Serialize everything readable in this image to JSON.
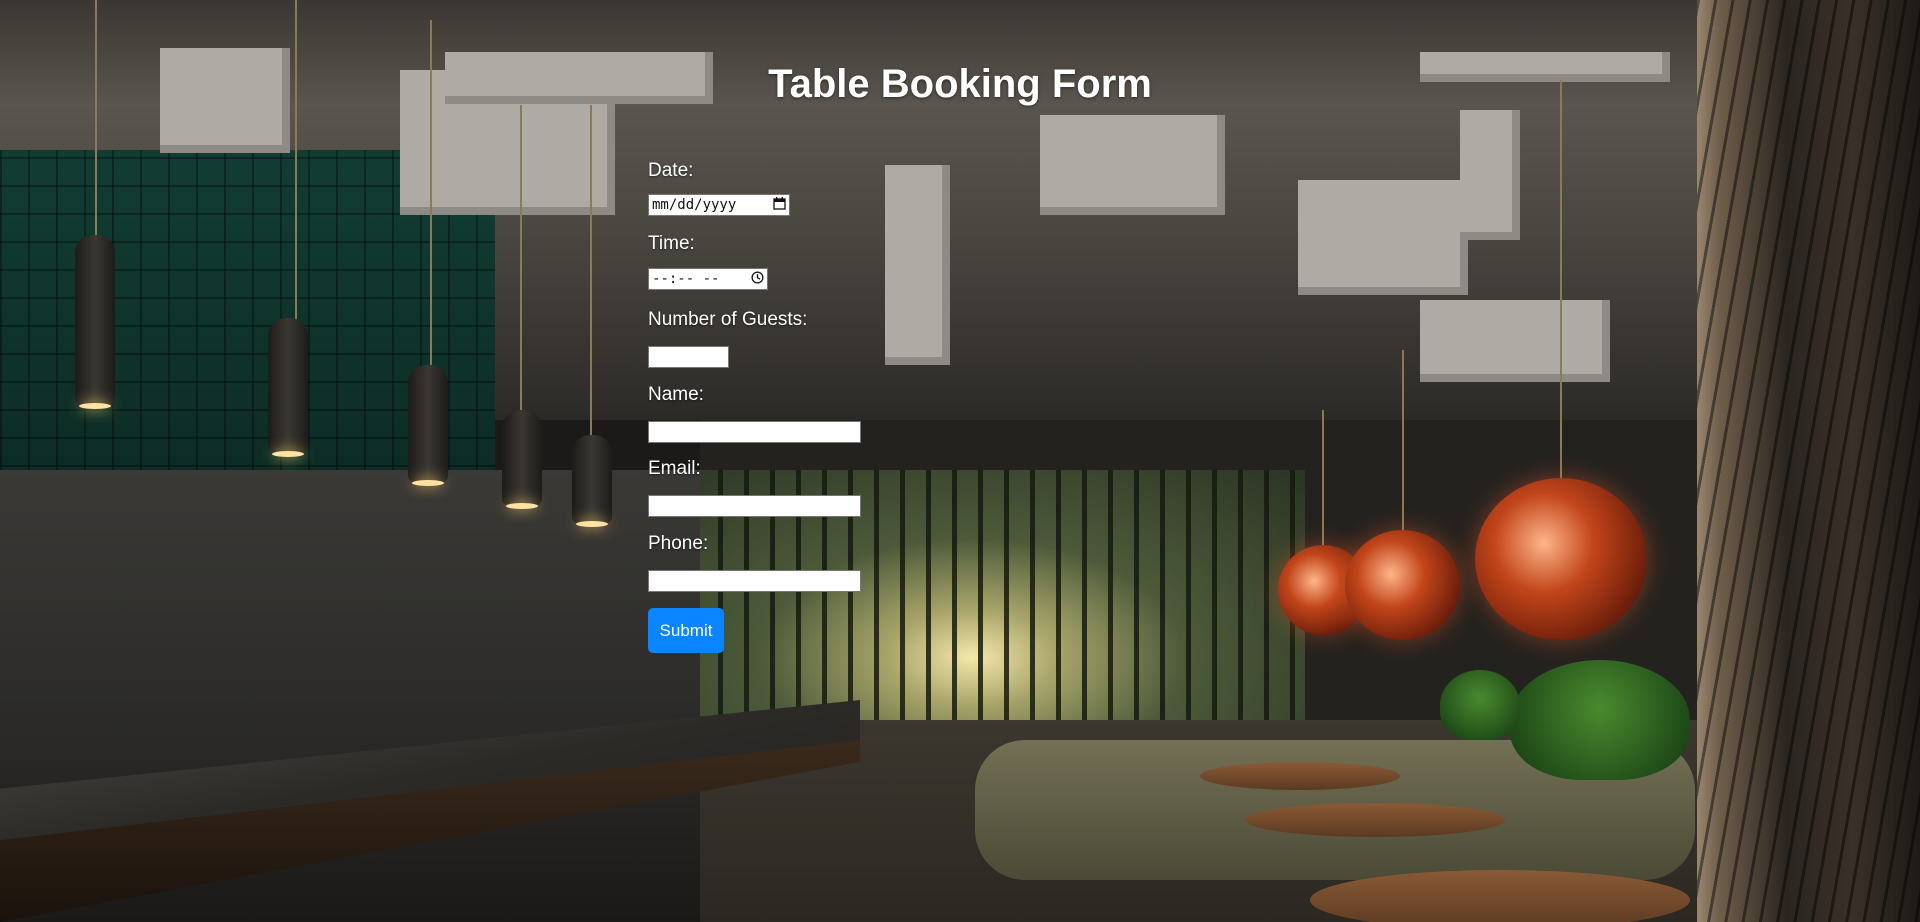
{
  "form": {
    "title": "Table Booking Form",
    "fields": {
      "date": {
        "label": "Date:",
        "placeholder": "mm/dd/yyyy",
        "value": ""
      },
      "time": {
        "label": "Time:",
        "placeholder": "--:-- --",
        "value": ""
      },
      "guests": {
        "label": "Number of Guests:",
        "value": ""
      },
      "name": {
        "label": "Name:",
        "value": ""
      },
      "email": {
        "label": "Email:",
        "value": ""
      },
      "phone": {
        "label": "Phone:",
        "value": ""
      }
    },
    "submit_label": "Submit",
    "icons": {
      "date": "calendar-icon",
      "time": "clock-icon"
    }
  },
  "colors": {
    "submit_button": "#0a84ff",
    "label_text": "#ffffff",
    "title_text": "#ffffff"
  },
  "background": {
    "description_icon": "restaurant-interior-photo"
  }
}
